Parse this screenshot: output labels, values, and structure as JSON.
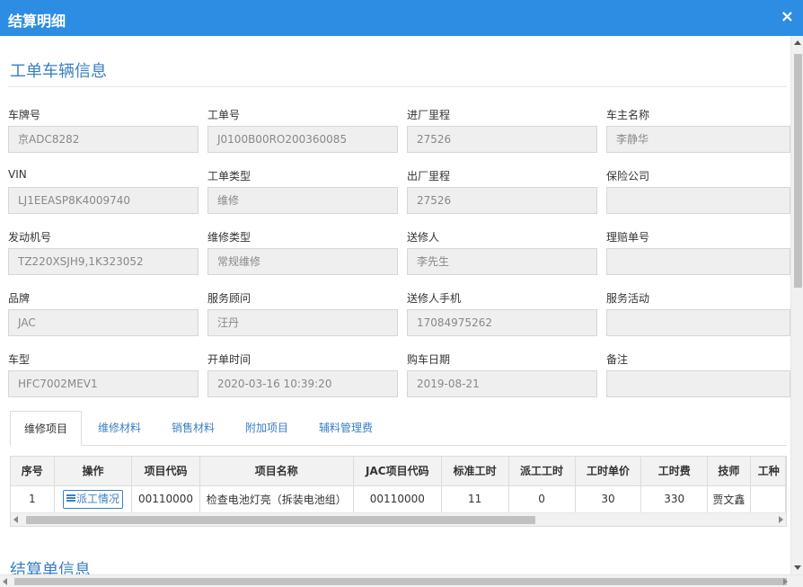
{
  "window": {
    "title": "结算明细",
    "close_label": "×"
  },
  "section1": {
    "title": "工单车辆信息"
  },
  "fields": [
    {
      "label": "车牌号",
      "value": "京ADC8282"
    },
    {
      "label": "工单号",
      "value": "J0100B00RO200360085"
    },
    {
      "label": "进厂里程",
      "value": "27526"
    },
    {
      "label": "车主名称",
      "value": "李静华"
    },
    {
      "label": "VIN",
      "value": "LJ1EEASP8K4009740"
    },
    {
      "label": "工单类型",
      "value": "维修"
    },
    {
      "label": "出厂里程",
      "value": "27526"
    },
    {
      "label": "保险公司",
      "value": ""
    },
    {
      "label": "发动机号",
      "value": "TZ220XSJH9,1K323052"
    },
    {
      "label": "维修类型",
      "value": "常规维修"
    },
    {
      "label": "送修人",
      "value": "李先生"
    },
    {
      "label": "理赔单号",
      "value": ""
    },
    {
      "label": "品牌",
      "value": "JAC"
    },
    {
      "label": "服务顾问",
      "value": "汪丹"
    },
    {
      "label": "送修人手机",
      "value": "17084975262"
    },
    {
      "label": "服务活动",
      "value": ""
    },
    {
      "label": "车型",
      "value": "HFC7002MEV1"
    },
    {
      "label": "开单时间",
      "value": "2020-03-16 10:39:20"
    },
    {
      "label": "购车日期",
      "value": "2019-08-21"
    },
    {
      "label": "备注",
      "value": ""
    }
  ],
  "tabs": [
    {
      "label": "维修项目",
      "active": true
    },
    {
      "label": "维修材料",
      "active": false
    },
    {
      "label": "销售材料",
      "active": false
    },
    {
      "label": "附加项目",
      "active": false
    },
    {
      "label": "辅料管理费",
      "active": false
    }
  ],
  "grid": {
    "headers": [
      "序号",
      "操作",
      "项目代码",
      "项目名称",
      "JAC项目代码",
      "标准工时",
      "派工工时",
      "工时单价",
      "工时费",
      "技师",
      "工种"
    ],
    "rows": [
      [
        "1",
        "派工情况",
        "00110000",
        "检查电池灯亮（拆装电池组）",
        "00110000",
        "11",
        "0",
        "30",
        "330",
        "贾文鑫",
        ""
      ]
    ]
  },
  "section2": {
    "title": "结算单信息"
  },
  "colors": {
    "titlebar": "#2d8de3",
    "accent": "#3a7fc4",
    "input_bg": "#efefef"
  }
}
